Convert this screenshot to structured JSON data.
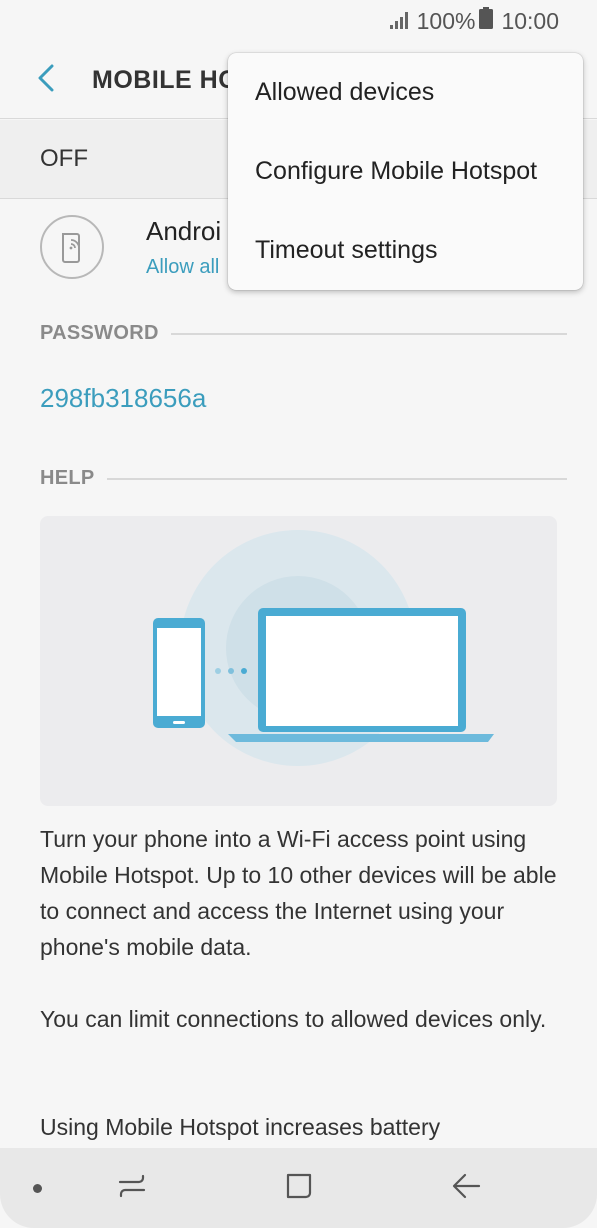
{
  "status_bar": {
    "signal_icon": "signal-bars-icon",
    "battery_percent": "100%",
    "battery_icon": "battery-full-icon",
    "time": "10:00"
  },
  "header": {
    "back_icon": "back-arrow-icon",
    "title": "MOBILE HOT"
  },
  "switch": {
    "state_label": "OFF"
  },
  "device": {
    "icon": "hotspot-device-icon",
    "name": "Androi",
    "subtitle": "Allow all"
  },
  "password_section": {
    "header": "PASSWORD",
    "value": "298fb318656a"
  },
  "help_section": {
    "header": "HELP",
    "illustration": "phone-sharing-to-laptop-illustration",
    "paragraphs": [
      "Turn your phone into a Wi-Fi access point using Mobile Hotspot. Up to 10 other devices will be able to connect and access the Internet using your phone's mobile data.",
      "You can limit connections to allowed devices only.",
      "Using Mobile Hotspot increases battery"
    ]
  },
  "overflow_menu": {
    "items": [
      {
        "label": "Allowed devices"
      },
      {
        "label": "Configure Mobile Hotspot"
      },
      {
        "label": "Timeout settings"
      }
    ]
  },
  "nav_bar": {
    "recents_icon": "recents-icon",
    "home_icon": "home-icon",
    "back_icon": "nav-back-icon"
  },
  "colors": {
    "accent": "#3b9dbd",
    "illustration_blue": "#4aabd3",
    "background": "#f6f6f6"
  }
}
